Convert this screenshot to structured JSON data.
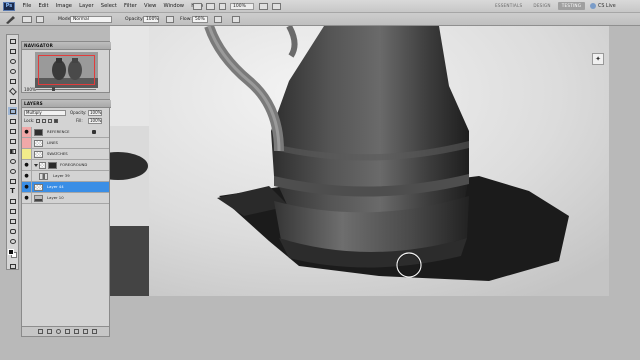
{
  "app": {
    "logo": "Ps"
  },
  "menu": [
    "File",
    "Edit",
    "Image",
    "Layer",
    "Select",
    "Filter",
    "View",
    "Window",
    "Help"
  ],
  "menubar": {
    "zoom": "100%"
  },
  "workspaces": [
    "ESSENTIALS",
    "DESIGN",
    "TESTING"
  ],
  "workspace_active": "TESTING",
  "cs_live": "CS Live",
  "options": {
    "mode_label": "Mode:",
    "mode_value": "Normal",
    "opacity_label": "Opacity:",
    "opacity_value": "100%",
    "flow_label": "Flow:",
    "flow_value": "50%"
  },
  "navigator": {
    "title": "NAVIGATOR",
    "zoom": "100%"
  },
  "layers": {
    "title": "LAYERS",
    "blend_mode": "Multiply",
    "opacity_label": "Opacity:",
    "opacity_value": "100%",
    "lock_label": "Lock:",
    "fill_label": "Fill:",
    "fill_value": "100%",
    "items": [
      {
        "name": "REFERENCE",
        "color": "#f0a8a8",
        "visible": true,
        "locked": true
      },
      {
        "name": "LINES",
        "color": "#f0a8a8",
        "visible": false
      },
      {
        "name": "SWATCHES",
        "color": "#f2ec8a",
        "visible": false
      },
      {
        "name": "FOREGROUND",
        "visible": true,
        "group": true
      },
      {
        "name": "Layer 39",
        "visible": true
      },
      {
        "name": "Layer 44",
        "visible": true,
        "selected": true
      },
      {
        "name": "Layer 10",
        "visible": true
      }
    ]
  },
  "colors": {
    "selected_layer": "#3a8ee6",
    "nav_view_box": "#e23c3c",
    "foreground": "#111111",
    "background": "#ffffff"
  },
  "icons": [
    "brush-icon",
    "eye-icon",
    "lock-icon",
    "push-pin-icon",
    "link-icon",
    "fx-icon",
    "mask-icon",
    "new-layer-icon",
    "trash-icon"
  ]
}
